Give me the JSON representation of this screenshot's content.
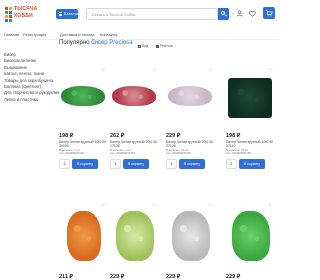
{
  "header": {
    "logo_line1": "ТЫСЯЧА",
    "logo_line2": "ХОББИ",
    "catalog_label": "Каталог",
    "search_placeholder": "Искать в Тысяча Хобби",
    "brand_colors": [
      "#e8412c",
      "#f2a91a",
      "#3aa54a",
      "#2f6fd6"
    ]
  },
  "nav": {
    "items": [
      "Главная",
      "Регистрация",
      "Доставка и оплата",
      "Контакты"
    ]
  },
  "sidebar": {
    "items": [
      "Бисер",
      "Бисероплетение",
      "Вышивание",
      "Шитье, ленты, ткани",
      "Товары для скрапбукинга",
      "Валяние (фелтинг)",
      "Для творчества и рукоделия",
      "Лепка и пластика"
    ]
  },
  "main": {
    "title_prefix": "Популярно ",
    "title_accent": "бисер Preciosa",
    "view_label": "Вид",
    "sort_label": "Рейтинг"
  },
  "products": [
    {
      "price": "198 ₽",
      "name": "Бисер Чехия круглый 10/0 50 39000",
      "meta": "В наличии: 5 шт\nАрт: 001000000149",
      "qty": "1",
      "buy": "В корзину",
      "color": "#2e8a3a",
      "color2": "#4fb45a"
    },
    {
      "price": "262 ₽",
      "name": "Бисер Чехия круглый 10/0 50 17198",
      "meta": "В наличии: 4 шт\nАрт: 001000000251",
      "qty": "1",
      "buy": "В корзину",
      "color": "#b23a4a",
      "color2": "#d8909a"
    },
    {
      "price": "229 ₽",
      "name": "Бисер Чехия круглый 10/0 50 37128",
      "meta": "В наличии: 10 шт\nАрт: 001000000315",
      "qty": "1",
      "buy": "В корзину",
      "color": "#c9b6c8",
      "color2": "#e4d6e2"
    },
    {
      "price": "198 ₽",
      "name": "Бисер Чехия круглый 10/0 50 57110",
      "meta": "В наличии: 10 шт\nАрт: 001000000158",
      "qty": "1",
      "buy": "В корзину",
      "color": "#0f2e22",
      "color2": "#1f4a36"
    },
    {
      "price": "211 ₽",
      "name": "",
      "meta": "",
      "qty": "",
      "buy": "",
      "color": "#d86a1e",
      "color2": "#f09a4a"
    },
    {
      "price": "229 ₽",
      "name": "",
      "meta": "",
      "qty": "",
      "buy": "",
      "color": "#9ec25a",
      "color2": "#d8e8a8"
    },
    {
      "price": "229 ₽",
      "name": "",
      "meta": "",
      "qty": "",
      "buy": "",
      "color": "#b8b8b8",
      "color2": "#e6e6e6"
    },
    {
      "price": "229 ₽",
      "name": "",
      "meta": "",
      "qty": "",
      "buy": "",
      "color": "#3aa83e",
      "color2": "#6ad06a"
    }
  ]
}
